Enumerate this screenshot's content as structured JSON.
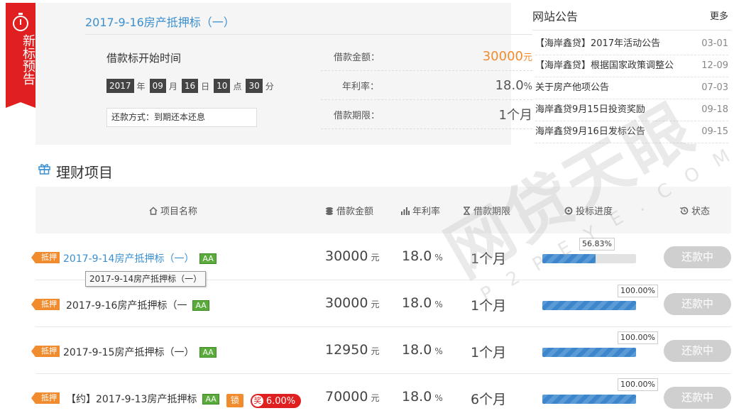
{
  "preview": {
    "ribbon_text": "新标预告",
    "title": "2017-9-16房产抵押标（一）",
    "start_label": "借款标开始时间",
    "time": {
      "year": "2017",
      "year_unit": "年",
      "month": "09",
      "month_unit": "月",
      "day": "16",
      "day_unit": "日",
      "hour": "10",
      "hour_unit": "点",
      "minute": "30",
      "minute_unit": "分"
    },
    "repay_method": "还款方式：到期还本还息",
    "amount_label": "借款金额：",
    "amount_value": "30000",
    "amount_unit": "元",
    "rate_label": "年利率：",
    "rate_value": "18.0",
    "rate_unit": "%",
    "term_label": "借款期限：",
    "term_value": "1个月"
  },
  "notices": {
    "title": "网站公告",
    "more": "更多",
    "items": [
      {
        "text": "【海岸鑫贷】2017年活动公告",
        "date": "03-01"
      },
      {
        "text": "【海岸鑫贷】根据国家政策调整公",
        "date": "12-09"
      },
      {
        "text": "关于房产他项公告",
        "date": "07-03"
      },
      {
        "text": "海岸鑫贷9月15日投资奖励",
        "date": "09-18"
      },
      {
        "text": "海岸鑫贷9月16日发标公告",
        "date": "09-15"
      }
    ]
  },
  "section": {
    "title": "理财项目"
  },
  "table": {
    "headers": {
      "name": "项目名称",
      "amount": "借款金额",
      "rate": "年利率",
      "term": "借款期限",
      "progress": "投标进度",
      "status": "状态"
    },
    "rows": [
      {
        "tag": "抵押",
        "name": "2017-9-14房产抵押标（一）",
        "badge": "AA",
        "amount": "30000",
        "amount_unit": "元",
        "rate": "18.0",
        "rate_unit": "%",
        "term": "1个月",
        "progress": 56.83,
        "progress_label": "56.83%",
        "status": "还款中"
      },
      {
        "tag": "抵押",
        "name": "2017-9-16房产抵押标（一",
        "badge": "AA",
        "amount": "30000",
        "amount_unit": "元",
        "rate": "18.0",
        "rate_unit": "%",
        "term": "1个月",
        "progress": 100,
        "progress_label": "100.00%",
        "status": "还款中"
      },
      {
        "tag": "抵押",
        "name": "2017-9-15房产抵押标（一）",
        "badge": "AA",
        "amount": "12950",
        "amount_unit": "元",
        "rate": "18.0",
        "rate_unit": "%",
        "term": "1个月",
        "progress": 100,
        "progress_label": "100.00%",
        "status": "还款中"
      },
      {
        "tag": "抵押",
        "name": "【约】2017-9-13房产抵押标",
        "badge": "AA",
        "lock_badge": "锁",
        "award_icon": "奖",
        "award_rate": "6.00%",
        "amount": "70000",
        "amount_unit": "元",
        "rate": "18.0",
        "rate_unit": "%",
        "term": "6个月",
        "progress": 100,
        "progress_label": "100.00%",
        "status": "还款中"
      }
    ],
    "tooltip": "2017-9-14房产抵押标（一）"
  },
  "watermark": {
    "main": "网贷天眼",
    "sub": "P2PEYE.COM"
  },
  "icons": {
    "ribbon": "stopwatch-icon",
    "section": "gift-icon",
    "name": "home-icon",
    "amount": "coins-icon",
    "rate": "bar-chart-icon",
    "term": "hourglass-icon",
    "progress": "progress-ring-icon",
    "status": "history-icon"
  },
  "colors": {
    "brand_red": "#e02020",
    "accent_blue": "#3a8fd0",
    "orange": "#f08c2e",
    "badge_green": "#5aab3c"
  }
}
